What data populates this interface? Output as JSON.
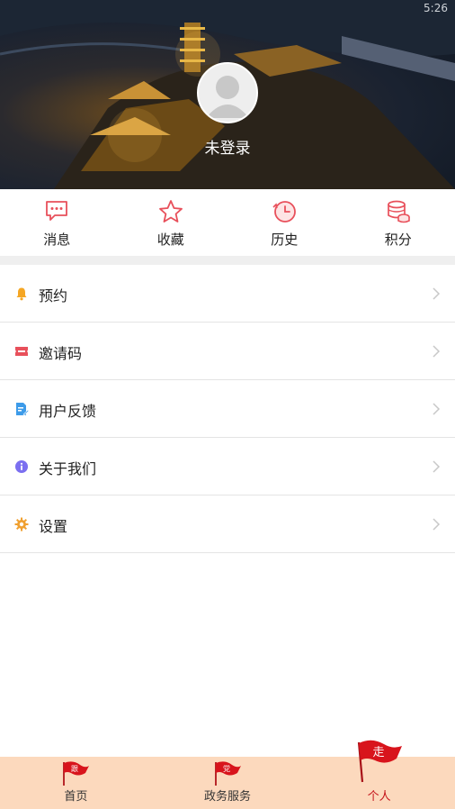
{
  "status_bar": {
    "time": "5:26"
  },
  "profile": {
    "login_text": "未登录"
  },
  "quick_actions": [
    {
      "label": "消息",
      "icon": "message-icon"
    },
    {
      "label": "收藏",
      "icon": "star-icon"
    },
    {
      "label": "历史",
      "icon": "history-clock-icon"
    },
    {
      "label": "积分",
      "icon": "points-coins-icon"
    }
  ],
  "menu": [
    {
      "label": "预约",
      "icon": "bell-icon",
      "color": "#f5a623"
    },
    {
      "label": "邀请码",
      "icon": "ticket-icon",
      "color": "#e8505b"
    },
    {
      "label": "用户反馈",
      "icon": "feedback-doc-icon",
      "color": "#3d9be9"
    },
    {
      "label": "关于我们",
      "icon": "info-icon",
      "color": "#7b6ff0"
    },
    {
      "label": "设置",
      "icon": "gear-icon",
      "color": "#f0a030"
    }
  ],
  "tabbar": [
    {
      "label": "首页",
      "icon": "flag-icon",
      "flag_text": "跟",
      "active": false
    },
    {
      "label": "政务服务",
      "icon": "flag-icon",
      "flag_text": "党",
      "active": false
    },
    {
      "label": "个人",
      "icon": "flag-icon",
      "flag_text": "走",
      "active": true
    }
  ],
  "colors": {
    "accent": "#c4141b",
    "tabbar_bg": "#fcd9bd",
    "icon_red": "#e8505b"
  }
}
